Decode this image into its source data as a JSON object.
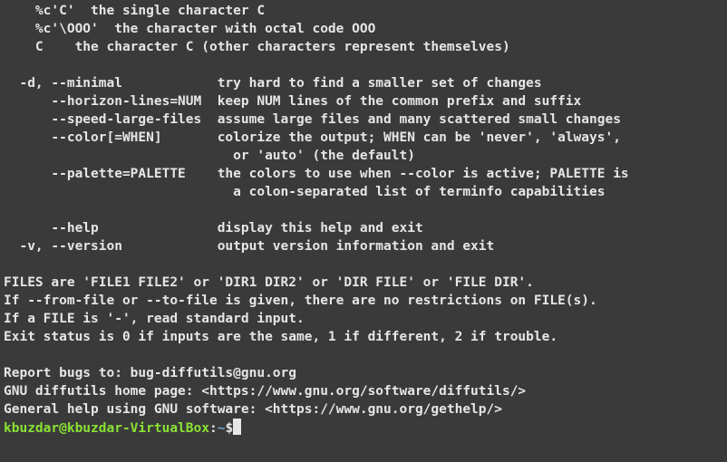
{
  "help": {
    "gfmt_line1": "    %c'C'  the single character C",
    "gfmt_line2": "    %c'\\OOO'  the character with octal code OOO",
    "gfmt_line3": "    C    the character C (other characters represent themselves)",
    "blank1": "",
    "opt_minimal": "  -d, --minimal            try hard to find a smaller set of changes",
    "opt_horizon": "      --horizon-lines=NUM  keep NUM lines of the common prefix and suffix",
    "opt_speed": "      --speed-large-files  assume large files and many scattered small changes",
    "opt_color1": "      --color[=WHEN]       colorize the output; WHEN can be 'never', 'always',",
    "opt_color2": "                             or 'auto' (the default)",
    "opt_palette1": "      --palette=PALETTE    the colors to use when --color is active; PALETTE is",
    "opt_palette2": "                             a colon-separated list of terminfo capabilities",
    "blank2": "",
    "opt_help": "      --help               display this help and exit",
    "opt_version": "  -v, --version            output version information and exit",
    "blank3": "",
    "files_line": "FILES are 'FILE1 FILE2' or 'DIR1 DIR2' or 'DIR FILE' or 'FILE DIR'.",
    "fromfile_line": "If --from-file or --to-file is given, there are no restrictions on FILE(s).",
    "stdin_line": "If a FILE is '-', read standard input.",
    "exitstatus_line": "Exit status is 0 if inputs are the same, 1 if different, 2 if trouble.",
    "blank4": "",
    "bugs_line": "Report bugs to: bug-diffutils@gnu.org",
    "homepage_line": "GNU diffutils home page: <https://www.gnu.org/software/diffutils/>",
    "general_line": "General help using GNU software: <https://www.gnu.org/gethelp/>"
  },
  "prompt": {
    "user_host": "kbuzdar@kbuzdar-VirtualBox",
    "colon": ":",
    "path": "~",
    "symbol": "$"
  }
}
